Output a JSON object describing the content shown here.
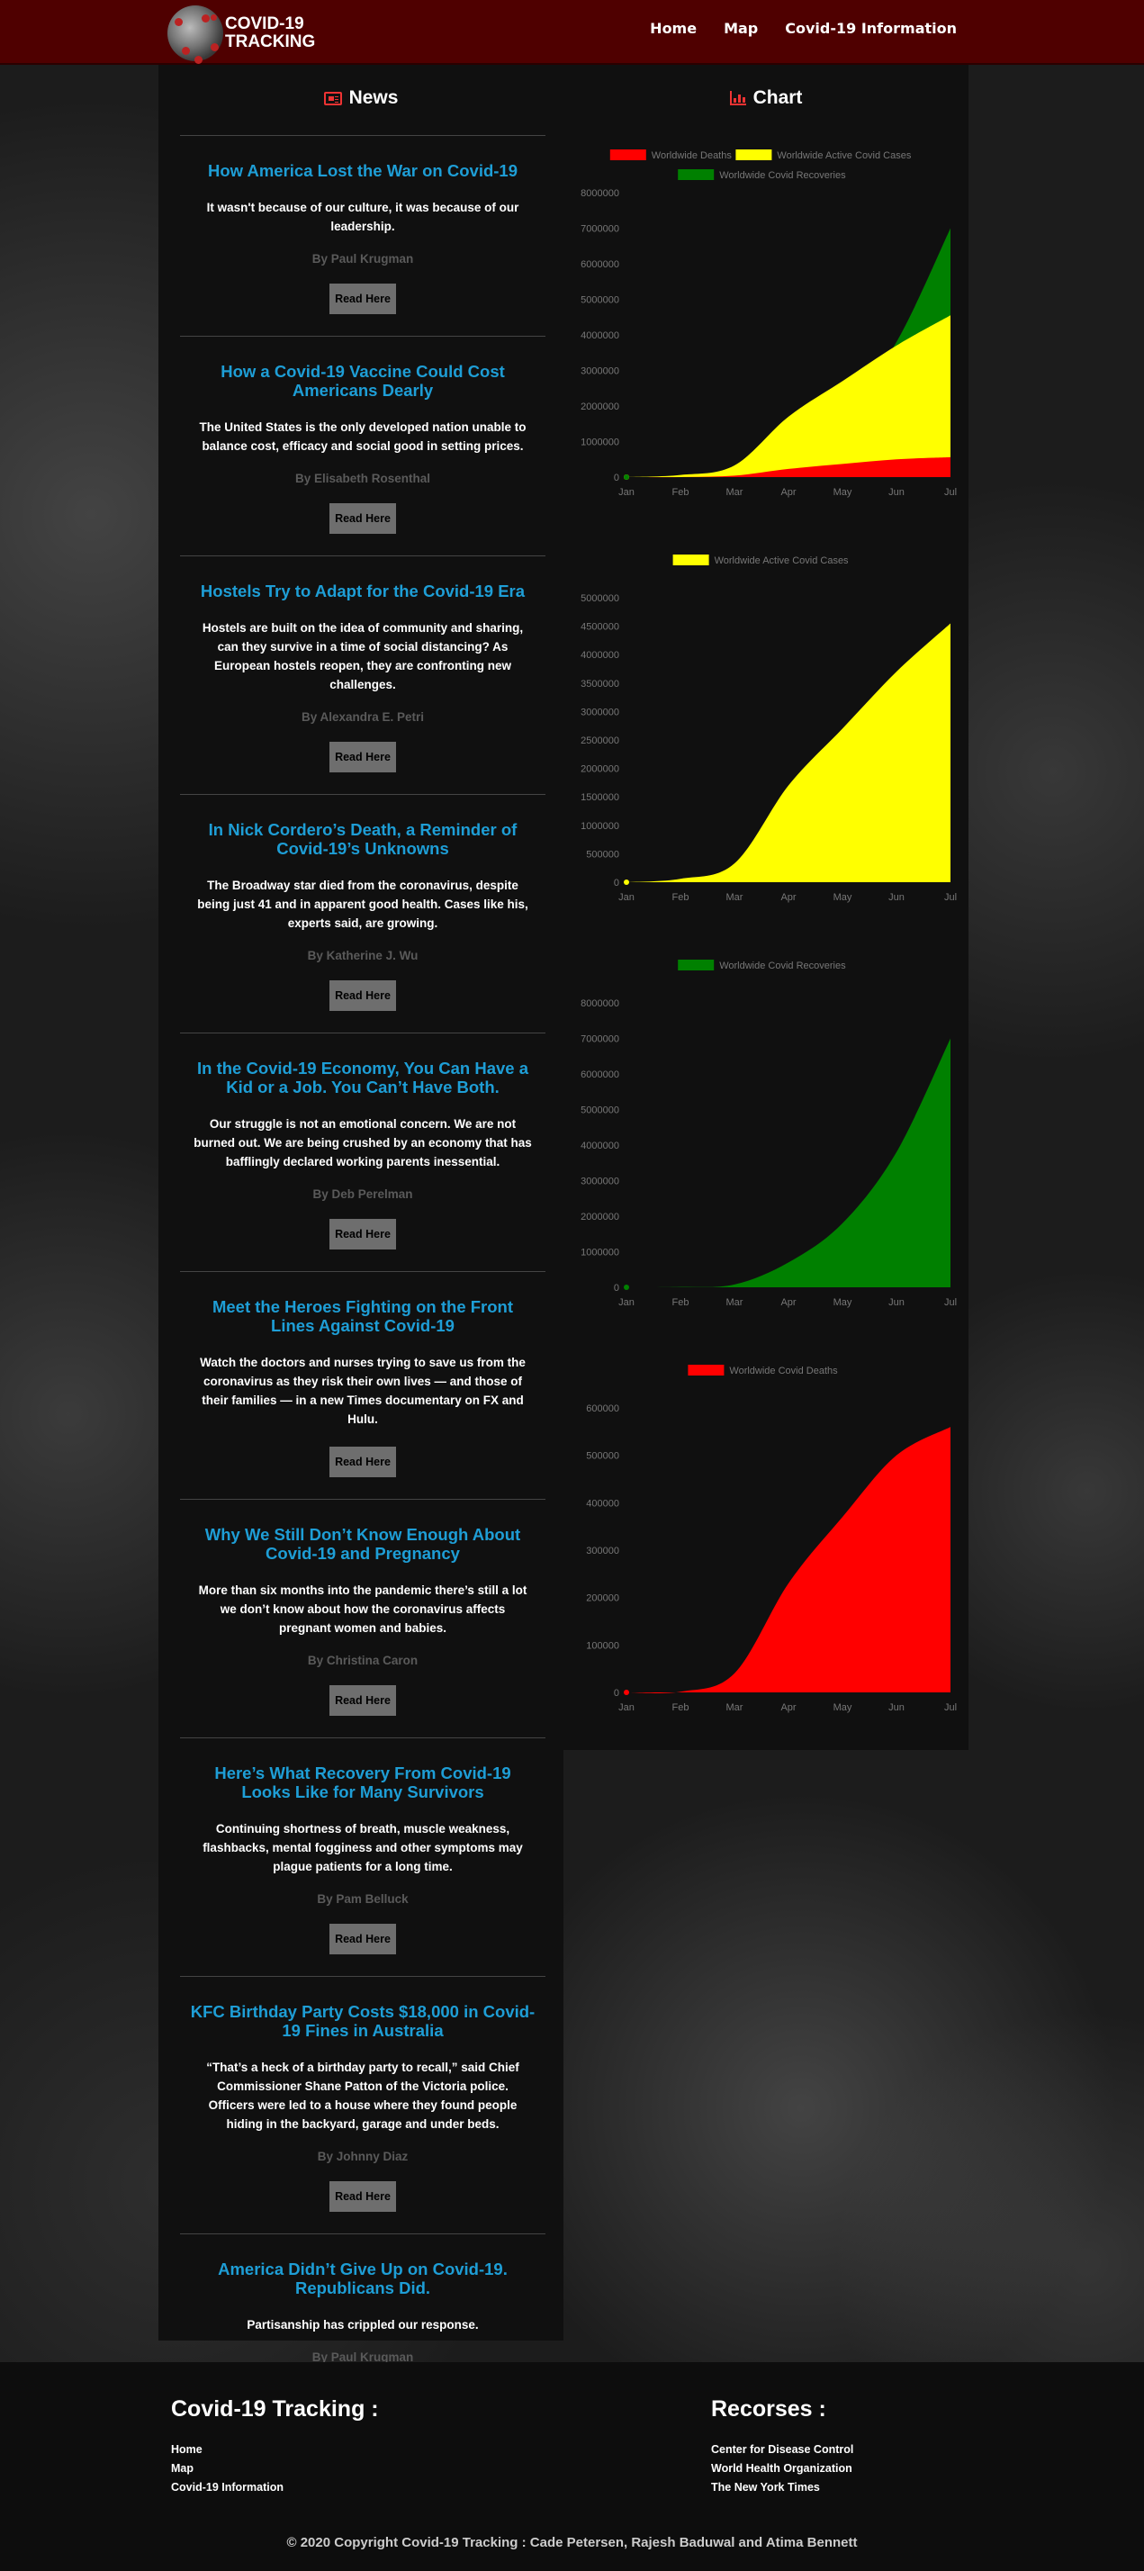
{
  "navbar": {
    "brand_line1": "COVID-19",
    "brand_line2": "TRACKING",
    "links": [
      "Home",
      "Map",
      "Covid-19 Information"
    ]
  },
  "news": {
    "heading": "News",
    "read_label": "Read Here",
    "articles": [
      {
        "title": "How America Lost the War on Covid-19",
        "summary": "It wasn't because of our culture, it was because of our leadership.",
        "author": "By Paul Krugman"
      },
      {
        "title": "How a Covid-19 Vaccine Could Cost Americans Dearly",
        "summary": "The United States is the only developed nation unable to balance cost, efficacy and social good in setting prices.",
        "author": "By Elisabeth Rosenthal"
      },
      {
        "title": "Hostels Try to Adapt for the Covid-19 Era",
        "summary": "Hostels are built on the idea of community and sharing, can they survive in a time of social distancing? As European hostels reopen, they are confronting new challenges.",
        "author": "By Alexandra E. Petri"
      },
      {
        "title": "In Nick Cordero’s Death, a Reminder of Covid-19’s Unknowns",
        "summary": "The Broadway star died from the coronavirus, despite being just 41 and in apparent good health. Cases like his, experts said, are growing.",
        "author": "By Katherine J. Wu"
      },
      {
        "title": "In the Covid-19 Economy, You Can Have a Kid or a Job. You Can’t Have Both.",
        "summary": "Our struggle is not an emotional concern. We are not burned out. We are being crushed by an economy that has bafflingly declared working parents inessential.",
        "author": "By Deb Perelman"
      },
      {
        "title": "Meet the Heroes Fighting on the Front Lines Against Covid-19",
        "summary": "Watch the doctors and nurses trying to save us from the coronavirus as they risk their own lives — and those of their families — in a new Times documentary on FX and Hulu.",
        "author": ""
      },
      {
        "title": "Why We Still Don’t Know Enough About Covid-19 and Pregnancy",
        "summary": "More than six months into the pandemic there’s still a lot we don’t know about how the coronavirus affects pregnant women and babies.",
        "author": "By Christina Caron"
      },
      {
        "title": "Here’s What Recovery From Covid-19 Looks Like for Many Survivors",
        "summary": "Continuing shortness of breath, muscle weakness, flashbacks, mental fogginess and other symptoms may plague patients for a long time.",
        "author": "By Pam Belluck"
      },
      {
        "title": "KFC Birthday Party Costs $18,000 in Covid-19 Fines in Australia",
        "summary": "“That’s a heck of a birthday party to recall,” said Chief Commissioner Shane Patton of the Victoria police. Officers were led to a house where they found people hiding in the backyard, garage and under beds.",
        "author": "By Johnny Diaz"
      },
      {
        "title": "America Didn’t Give Up on Covid-19. Republicans Did.",
        "summary": "Partisanship has crippled our response.",
        "author": "By Paul Krugman"
      }
    ]
  },
  "chart": {
    "heading": "Chart"
  },
  "colors": {
    "deaths": "#ff0000",
    "active": "#ffff00",
    "recoveries": "#008000",
    "navbar": "#4f0000",
    "link": "#1e9ed6"
  },
  "chart_data": [
    {
      "type": "area",
      "x": [
        "Jan",
        "Feb",
        "Mar",
        "Apr",
        "May",
        "Jun",
        "Jul"
      ],
      "ylim": [
        0,
        8000000
      ],
      "yticks": [
        0,
        1000000,
        2000000,
        3000000,
        4000000,
        5000000,
        6000000,
        7000000,
        8000000
      ],
      "legend_position": "top",
      "series": [
        {
          "name": "Worldwide Deaths",
          "color": "#ff0000",
          "values": [
            0,
            1500,
            40000,
            230000,
            370000,
            500000,
            560000
          ]
        },
        {
          "name": "Worldwide Active Covid Cases",
          "color": "#ffff00",
          "values": [
            0,
            60000,
            330000,
            1700000,
            2700000,
            3700000,
            4550000
          ]
        },
        {
          "name": "Worldwide Covid Recoveries",
          "color": "#008000",
          "values": [
            0,
            8000,
            80000,
            700000,
            1800000,
            3800000,
            7000000
          ]
        }
      ]
    },
    {
      "type": "area",
      "x": [
        "Jan",
        "Feb",
        "Mar",
        "Apr",
        "May",
        "Jun",
        "Jul"
      ],
      "ylim": [
        0,
        5000000
      ],
      "yticks": [
        0,
        500000,
        1000000,
        1500000,
        2000000,
        2500000,
        3000000,
        3500000,
        4000000,
        4500000,
        5000000
      ],
      "legend_position": "top",
      "series": [
        {
          "name": "Worldwide Active Covid Cases",
          "color": "#ffff00",
          "values": [
            0,
            60000,
            330000,
            1700000,
            2700000,
            3700000,
            4550000
          ]
        }
      ]
    },
    {
      "type": "area",
      "x": [
        "Jan",
        "Feb",
        "Mar",
        "Apr",
        "May",
        "Jun",
        "Jul"
      ],
      "ylim": [
        0,
        8000000
      ],
      "yticks": [
        0,
        1000000,
        2000000,
        3000000,
        4000000,
        5000000,
        6000000,
        7000000,
        8000000
      ],
      "legend_position": "top",
      "series": [
        {
          "name": "Worldwide Covid Recoveries",
          "color": "#008000",
          "values": [
            0,
            8000,
            80000,
            700000,
            1800000,
            3800000,
            7000000
          ]
        }
      ]
    },
    {
      "type": "area",
      "x": [
        "Jan",
        "Feb",
        "Mar",
        "Apr",
        "May",
        "Jun",
        "Jul"
      ],
      "ylim": [
        0,
        600000
      ],
      "yticks": [
        0,
        100000,
        200000,
        300000,
        400000,
        500000,
        600000
      ],
      "legend_position": "top",
      "series": [
        {
          "name": "Worldwide Covid Deaths",
          "color": "#ff0000",
          "values": [
            0,
            1500,
            40000,
            230000,
            370000,
            500000,
            560000
          ]
        }
      ]
    }
  ],
  "footer": {
    "title": "Covid-19 Tracking :",
    "links": [
      "Home",
      "Map",
      "Covid-19 Information"
    ],
    "resources_title": "Recorses :",
    "resources": [
      "Center for Disease Control",
      "World Health Organization",
      "The New York Times"
    ],
    "copyright": "© 2020 Copyright Covid-19 Tracking : Cade Petersen, Rajesh Baduwal and Atima Bennett"
  }
}
